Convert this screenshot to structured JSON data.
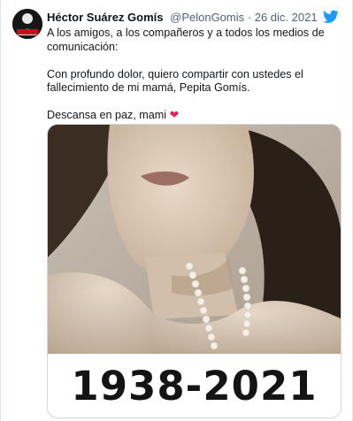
{
  "tweet": {
    "author_name": "Héctor Suárez Gomís",
    "handle": "@PelonGomis",
    "separator": "·",
    "date": "26 dic. 2021",
    "lines": [
      "A los amigos, a los compañeros y a todos los medios de comunicación:",
      "Con profundo dolor, quiero compartir con ustedes el fallecimiento de mi mamá, Pepita Gomís.",
      "Descansa en paz, mami"
    ],
    "emoji": "❤"
  },
  "media": {
    "caption": "1938-2021"
  },
  "icons": {
    "logo": "twitter-bird-icon",
    "avatar": "profile-avatar"
  },
  "colors": {
    "twitter_blue": "#1d9bf0",
    "heart_red": "#e0245e",
    "meta_gray": "#536471"
  }
}
